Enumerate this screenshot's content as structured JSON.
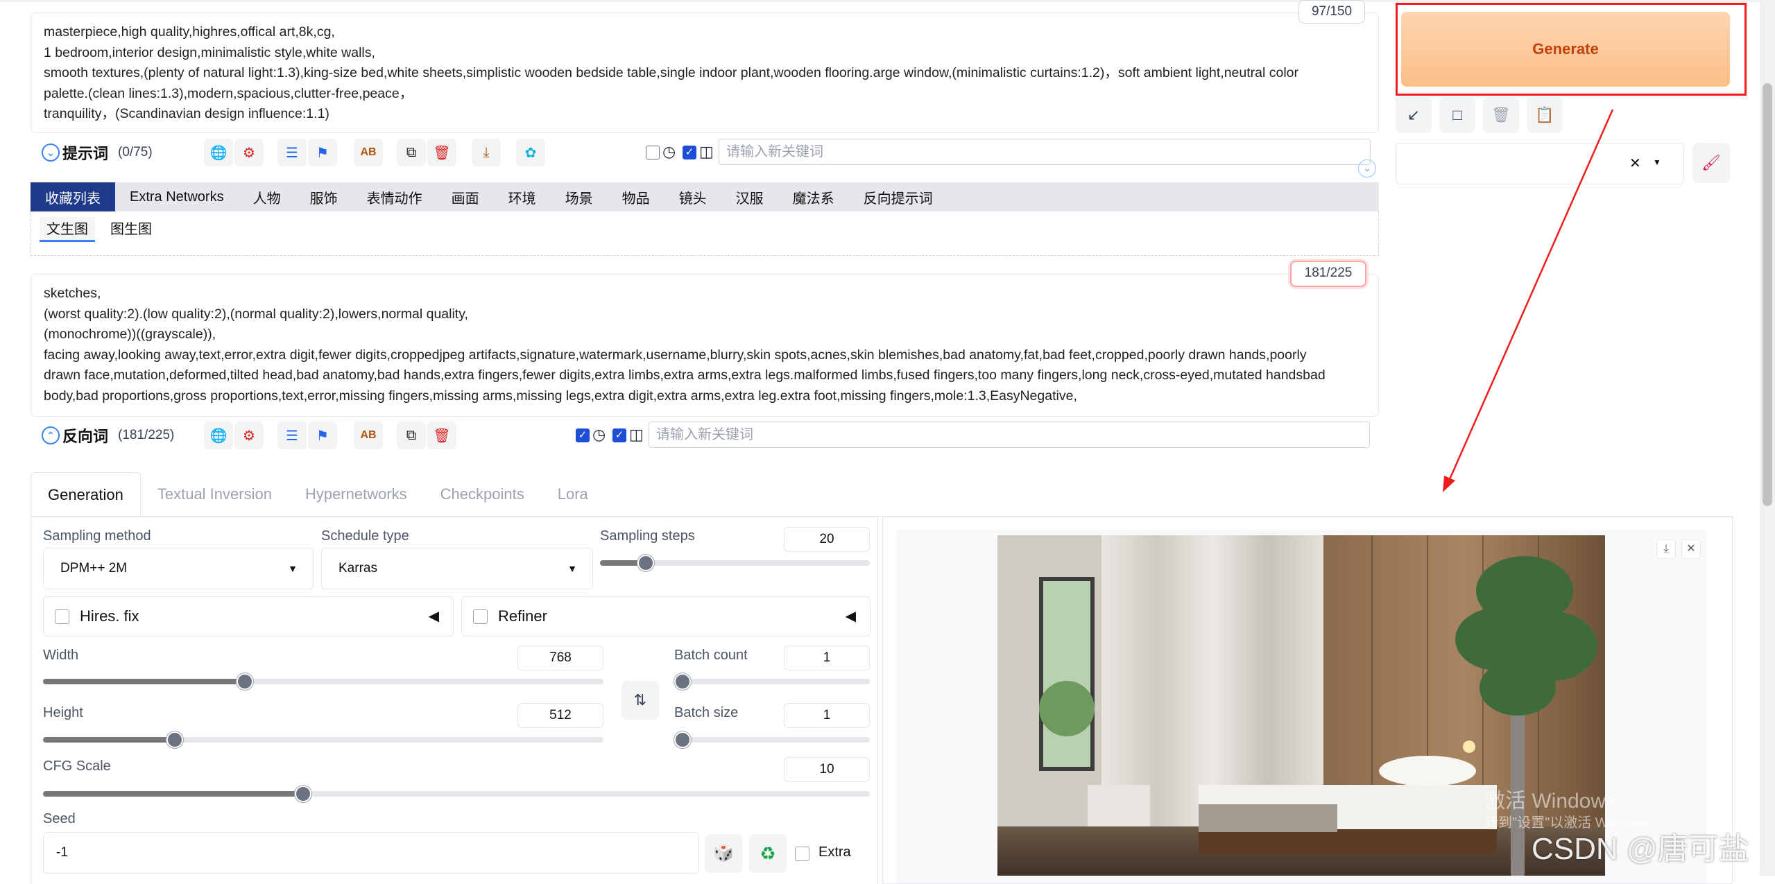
{
  "prompt": {
    "counter": "97/150",
    "lines": [
      "masterpiece,high quality,highres,offical art,8k,cg,",
      "1 bedroom,interior design,minimalistic style,white walls,",
      "smooth textures,(plenty of natural light:1.3),king-size bed,white sheets,simplistic wooden bedside table,single indoor plant,wooden flooring.arge window,(minimalistic curtains:1.2)，soft ambient light,neutral color",
      "palette.(clean lines:1.3),modern,spacious,clutter-free,peace，",
      "tranquility，(Scandinavian design influence:1.1)"
    ],
    "toolbar_title": "提示词",
    "toolbar_count": "(0/75)",
    "keyword_placeholder": "请输入新关键词"
  },
  "tabs": [
    "收藏列表",
    "Extra Networks",
    "人物",
    "服饰",
    "表情动作",
    "画面",
    "环境",
    "场景",
    "物品",
    "镜头",
    "汉服",
    "魔法系",
    "反向提示词"
  ],
  "subtabs": [
    "文生图",
    "图生图"
  ],
  "negative": {
    "counter": "181/225",
    "lines": [
      "sketches,",
      "(worst quality:2).(low quality:2),(normal quality:2),lowers,normal quality,",
      "(monochrome))((grayscale)),",
      "facing away,looking away,text,error,extra digit,fewer digits,croppedjpeg artifacts,signature,watermark,username,blurry,skin spots,acnes,skin blemishes,bad anatomy,fat,bad feet,cropped,poorly drawn hands,poorly",
      "drawn face,mutation,deformed,tilted head,bad anatomy,bad hands,extra fingers,fewer digits,extra limbs,extra arms,extra legs.malformed limbs,fused fingers,too many fingers,long neck,cross-eyed,mutated handsbad",
      "body,bad proportions,gross proportions,text,error,missing fingers,missing arms,missing legs,extra digit,extra arms,extra leg.extra foot,missing fingers,mole:1.3,EasyNegative,"
    ],
    "toolbar_title": "反向词",
    "toolbar_count": "(181/225)",
    "keyword_placeholder": "请输入新关键词"
  },
  "generate_label": "Generate",
  "gen_tabs": [
    "Generation",
    "Textual Inversion",
    "Hypernetworks",
    "Checkpoints",
    "Lora"
  ],
  "params": {
    "sampling_method_label": "Sampling method",
    "sampling_method": "DPM++ 2M",
    "schedule_type_label": "Schedule type",
    "schedule_type": "Karras",
    "sampling_steps_label": "Sampling steps",
    "sampling_steps": "20",
    "sampling_steps_fraction": 0.17,
    "hires_label": "Hires. fix",
    "refiner_label": "Refiner",
    "width_label": "Width",
    "width": "768",
    "width_fraction": 0.36,
    "height_label": "Height",
    "height": "512",
    "height_fraction": 0.235,
    "batch_count_label": "Batch count",
    "batch_count": "1",
    "batch_size_label": "Batch size",
    "batch_size": "1",
    "cfg_label": "CFG Scale",
    "cfg": "10",
    "cfg_fraction": 0.315,
    "seed_label": "Seed",
    "seed": "-1",
    "extra_label": "Extra"
  },
  "watermark": {
    "line1": "激活 Windows",
    "line2": "转到\"设置\"以激活 Windows。",
    "csdn": "CSDN @唐可盐"
  },
  "colors": {
    "accent": "#1e3a8a",
    "generate": "#fbbf88",
    "highlight": "#ef1d1d"
  }
}
